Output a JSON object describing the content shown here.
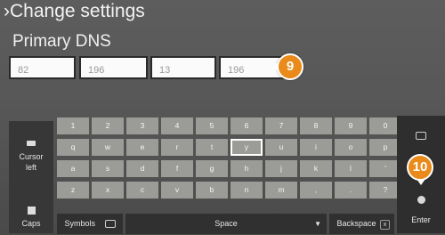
{
  "header": {
    "title": "Change settings",
    "subtitle": "Primary DNS"
  },
  "dns_fields": [
    "82",
    "196",
    "13",
    "196"
  ],
  "callouts": {
    "step_a": "9",
    "step_b": "10"
  },
  "colors": {
    "badge": "#e98a1a",
    "key": "#9b9b98",
    "panel": "#303030"
  },
  "keyboard": {
    "rows": [
      [
        "1",
        "2",
        "3",
        "4",
        "5",
        "6",
        "7",
        "8",
        "9",
        "0"
      ],
      [
        "q",
        "w",
        "e",
        "r",
        "t",
        "y",
        "u",
        "i",
        "o",
        "p"
      ],
      [
        "a",
        "s",
        "d",
        "f",
        "g",
        "h",
        "j",
        "k",
        "l",
        "'"
      ],
      [
        "z",
        "x",
        "c",
        "v",
        "b",
        "n",
        "m",
        ",",
        ".",
        "?"
      ]
    ],
    "selected_key": "y",
    "side_keys": {
      "cursor_left": "Cursor left",
      "caps": "Caps"
    },
    "bottom": {
      "symbols": "Symbols",
      "space": "Space",
      "backspace": "Backspace",
      "enter": "Enter",
      "space_icon": "chevron-down-icon",
      "backspace_icon": "x-icon"
    }
  }
}
